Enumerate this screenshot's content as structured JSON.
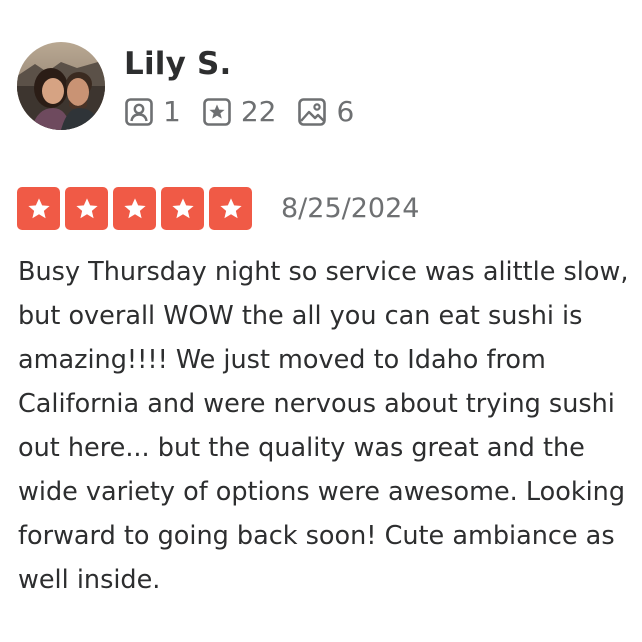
{
  "reviewer": {
    "name": "Lily S.",
    "avatar": "reviewer-photo",
    "stats": [
      {
        "icon": "friends-icon",
        "value": "1"
      },
      {
        "icon": "review-star-icon",
        "value": "22"
      },
      {
        "icon": "photo-icon",
        "value": "6"
      }
    ]
  },
  "review": {
    "rating": 5,
    "rating_max": 5,
    "rating_color": "#f05a46",
    "date": "8/25/2024",
    "text": "Busy Thursday night so service was alittle slow, but overall WOW the all you can eat sushi is amazing!!!! We just moved to Idaho from California and were nervous about trying sushi out here... but the quality was great and the wide variety of options were awesome. Looking forward to going back soon! Cute ambiance as well inside."
  }
}
